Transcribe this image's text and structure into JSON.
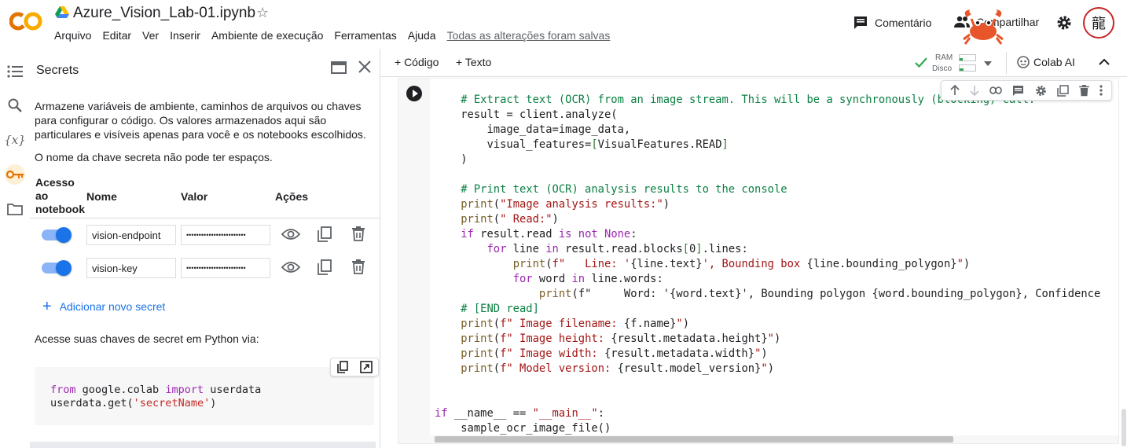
{
  "header": {
    "notebook_title": "Azure_Vision_Lab-01.ipynb",
    "menu": [
      "Arquivo",
      "Editar",
      "Ver",
      "Inserir",
      "Ambiente de execução",
      "Ferramentas",
      "Ajuda"
    ],
    "saved_status": "Todas as alterações foram salvas",
    "comment_label": "Comentário",
    "share_label": "Compartilhar",
    "avatar_glyph": "龍",
    "logo_text": "CO",
    "accent_color": "#f9ab00",
    "logo_color2": "#e37400"
  },
  "rail": {
    "icons": [
      "table-of-contents-icon",
      "search-icon",
      "variables-icon",
      "key-icon",
      "folder-icon"
    ],
    "variables_glyph": "{x}"
  },
  "secrets": {
    "title": "Secrets",
    "description": "Armazene variáveis de ambiente, caminhos de arquivos ou chaves para configurar o código. Os valores armazenados aqui são particulares e visíveis apenas para você e os notebooks escolhidos.",
    "note": "O nome da chave secreta não pode ter espaços.",
    "columns": {
      "access": "Acesso ao notebook",
      "name": "Nome",
      "value": "Valor",
      "actions": "Ações"
    },
    "rows": [
      {
        "name": "vision-endpoint",
        "value": "••••••••••••••••••••••••",
        "access": true
      },
      {
        "name": "vision-key",
        "value": "••••••••••••••••••••••••",
        "access": true
      }
    ],
    "add_label": "Adicionar novo secret",
    "access_note": "Acesse suas chaves de secret em Python via:",
    "snippet_line1_kw1": "from",
    "snippet_line1_mod": " google.colab ",
    "snippet_line1_kw2": "import",
    "snippet_line1_name": " userdata",
    "snippet_line2_call": "userdata.get(",
    "snippet_line2_str": "'secretName'",
    "snippet_line2_end": ")"
  },
  "toolbar": {
    "code_label": "+ Código",
    "text_label": "+ Texto",
    "ram_label": "RAM",
    "disk_label": "Disco",
    "ai_label": "Colab AI"
  },
  "cell": {
    "code_lines": [
      "    # Extract text (OCR) from an image stream. This will be a synchronously (blocking) call.",
      "    result = client.analyze(",
      "        image_data=image_data,",
      "        visual_features=[VisualFeatures.READ]",
      "    )",
      "",
      "    # Print text (OCR) analysis results to the console",
      "    print(\"Image analysis results:\")",
      "    print(\" Read:\")",
      "    if result.read is not None:",
      "        for line in result.read.blocks[0].lines:",
      "            print(f\"   Line: '{line.text}', Bounding box {line.bounding_polygon}\")",
      "            for word in line.words:",
      "                print(f\"     Word: '{word.text}', Bounding polygon {word.bounding_polygon}, Confidence",
      "    # [END read]",
      "    print(f\" Image filename: {f.name}\")",
      "    print(f\" Image height: {result.metadata.height}\")",
      "    print(f\" Image width: {result.metadata.width}\")",
      "    print(f\" Model version: {result.model_version}\")",
      "",
      "",
      "if __name__ == \"__main__\":",
      "    sample_ocr_image_file()"
    ]
  }
}
